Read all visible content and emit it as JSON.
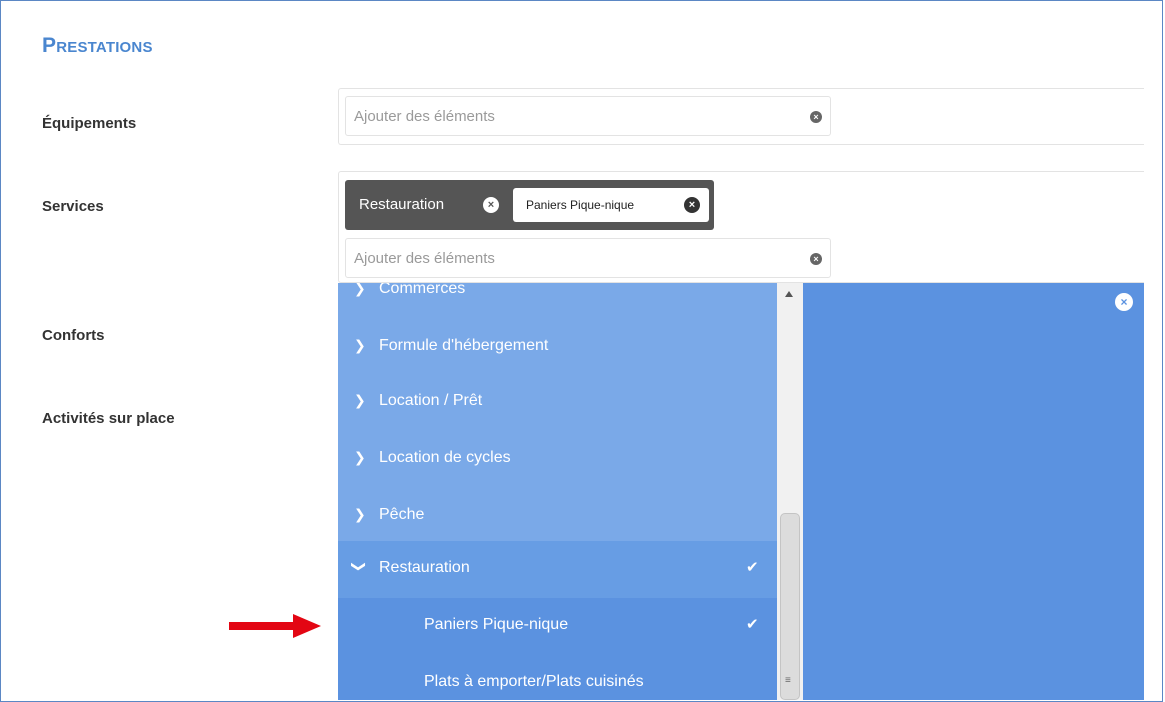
{
  "section": {
    "title_first": "P",
    "title_rest": "RESTATIONS"
  },
  "labels": {
    "equipements": "Équipements",
    "services": "Services",
    "conforts": "Conforts",
    "activites": "Activités sur place"
  },
  "equipements_input": {
    "placeholder": "Ajouter des éléments",
    "clear_glyph": "×"
  },
  "services_input": {
    "placeholder": "Ajouter des éléments",
    "clear_glyph": "×",
    "selected_tags": [
      {
        "label": "Restauration",
        "remove_glyph": "×",
        "children": [
          {
            "label": "Paniers Pique-nique",
            "remove_glyph": "×"
          }
        ]
      }
    ]
  },
  "dropdown": {
    "close_glyph": "×",
    "collapsed_glyph": "❯",
    "expanded_glyph": "❯",
    "check_glyph": "✔",
    "scroll_grip": "≡",
    "items": [
      {
        "label": "Commerces",
        "state": "collapsed"
      },
      {
        "label": "Formule d'hébergement",
        "state": "collapsed"
      },
      {
        "label": "Location / Prêt",
        "state": "collapsed"
      },
      {
        "label": "Location de cycles",
        "state": "collapsed"
      },
      {
        "label": "Pêche",
        "state": "collapsed"
      },
      {
        "label": "Restauration",
        "state": "expanded",
        "checked": true
      },
      {
        "label": "Paniers Pique-nique",
        "state": "child",
        "checked": true
      },
      {
        "label": "Plats à emporter/Plats cuisinés",
        "state": "child",
        "checked": false
      }
    ]
  },
  "annotation": {
    "arrow_color": "#e30613"
  },
  "colors": {
    "accent": "#4a86cf",
    "dropdown_bg": "#5b92e0",
    "dropdown_list_bg": "#7aa9e8",
    "tag_bg": "#555555"
  }
}
